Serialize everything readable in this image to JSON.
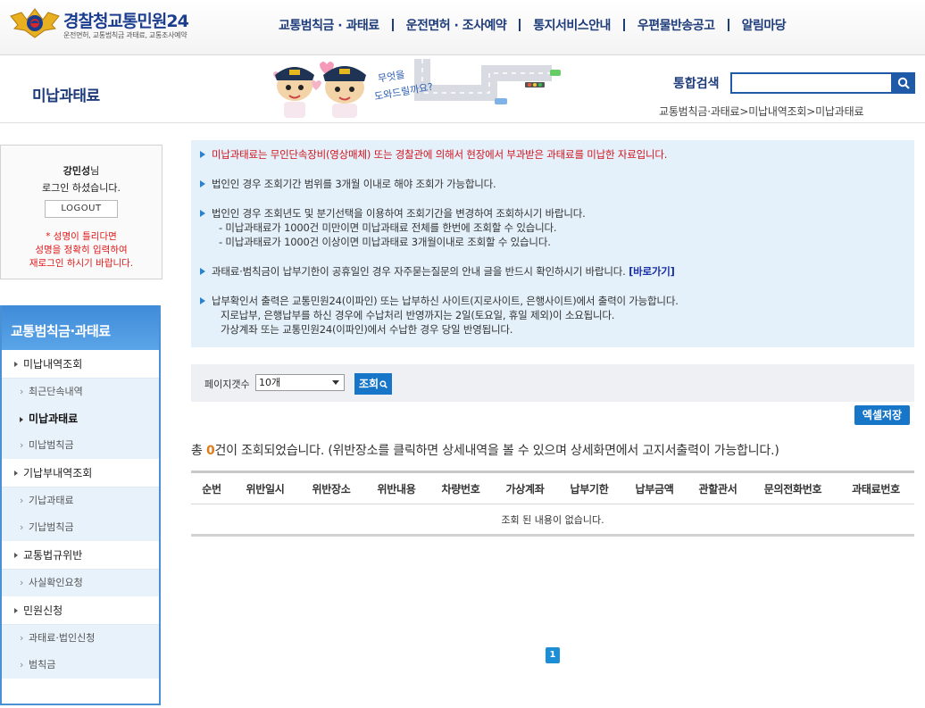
{
  "logo": {
    "title_main": "경찰청",
    "title_brand": "교통민원24",
    "subtitle": "운전면허, 교통범칙금 과태료, 교통조사예약"
  },
  "gnb": [
    {
      "label": "교통범칙금 · 과태료"
    },
    {
      "label": "운전면허 · 조사예약"
    },
    {
      "label": "통지서비스안내"
    },
    {
      "label": "우편물반송공고"
    },
    {
      "label": "알림마당"
    }
  ],
  "page_title": "미납과태료",
  "mascot": {
    "speech": "무엇을 도와드릴까요?"
  },
  "search": {
    "label": "통합검색",
    "value": ""
  },
  "breadcrumb": "교통범칙금·과태료>미납내역조회>미납과태료",
  "login": {
    "name": "강민성",
    "name_suffix": "님",
    "message": "로그인 하셨습니다.",
    "logout_label": "LOGOUT",
    "warn_line1": "* 성명이 틀리다면",
    "warn_line2": "성명을 정확히 입력하여",
    "warn_line3": "재로그인 하시기 바랍니다."
  },
  "lnb": {
    "head": "교통범칙금·과태료",
    "groups": [
      {
        "label": "미납내역조회",
        "items": [
          "최근단속내역",
          "미납과태료",
          "미납범칙금"
        ]
      },
      {
        "label": "기납부내역조회",
        "items": [
          "기납과태료",
          "기납범칙금"
        ]
      },
      {
        "label": "교통법규위반",
        "items": [
          "사실확인요청"
        ]
      },
      {
        "label": "민원신청",
        "items": [
          "과태료·법인신청",
          "범칙금"
        ]
      }
    ]
  },
  "info": {
    "p1": "미납과태료는 무인단속장비(영상매체) 또는 경찰관에 의해서 현장에서 부과받은 과태료를 미납한 자료입니다.",
    "p2": "법인인 경우 조회기간 범위를 3개월 이내로 해야 조회가 가능합니다.",
    "p3": "법인인 경우 조회년도 및 분기선택을 이용하여 조회기간을 변경하여 조회하시기 바랍니다.",
    "p3_sub1": "- 미납과태료가 1000건 미만이면 미납과태료 전체를 한번에 조회할 수 있습니다.",
    "p3_sub2": "- 미납과태료가 1000건 이상이면 미납과태료 3개월이내로 조회할 수 있습니다.",
    "p4": "과태료·범칙금이 납부기한이 공휴일인 경우 자주묻는질문의 안내 글을 반드시 확인하시기 바랍니다.",
    "p4_link": "[바로가기]",
    "p5": "납부확인서 출력은 교통민원24(이파인) 또는 납부하신 사이트(지로사이트, 은행사이트)에서 출력이 가능합니다.",
    "p5_sub1": "지로납부, 은행납부를 하신 경우에 수납처리 반영까지는 2일(토요일, 휴일 제외)이 소요됩니다.",
    "p5_sub2": "가상계좌 또는 교통민원24(이파인)에서 수납한 경우 당일 반영됩니다."
  },
  "filter": {
    "label": "페이지갯수",
    "selected": "10개",
    "query_label": "조회"
  },
  "excel_label": "엑셀저장",
  "total": {
    "prefix": "총 ",
    "count": "0",
    "suffix": "건이 조회되었습니다. (위반장소를 클릭하면 상세내역을 볼 수 있으며 상세화면에서 고지서출력이 가능합니다.)"
  },
  "table": {
    "headers": [
      "순번",
      "위반일시",
      "위반장소",
      "위반내용",
      "차량번호",
      "가상계좌",
      "납부기한",
      "납부금액",
      "관할관서",
      "문의전화번호",
      "과태료번호"
    ],
    "empty_message": "조회 된 내용이 없습니다."
  },
  "pagination": {
    "current": "1"
  }
}
